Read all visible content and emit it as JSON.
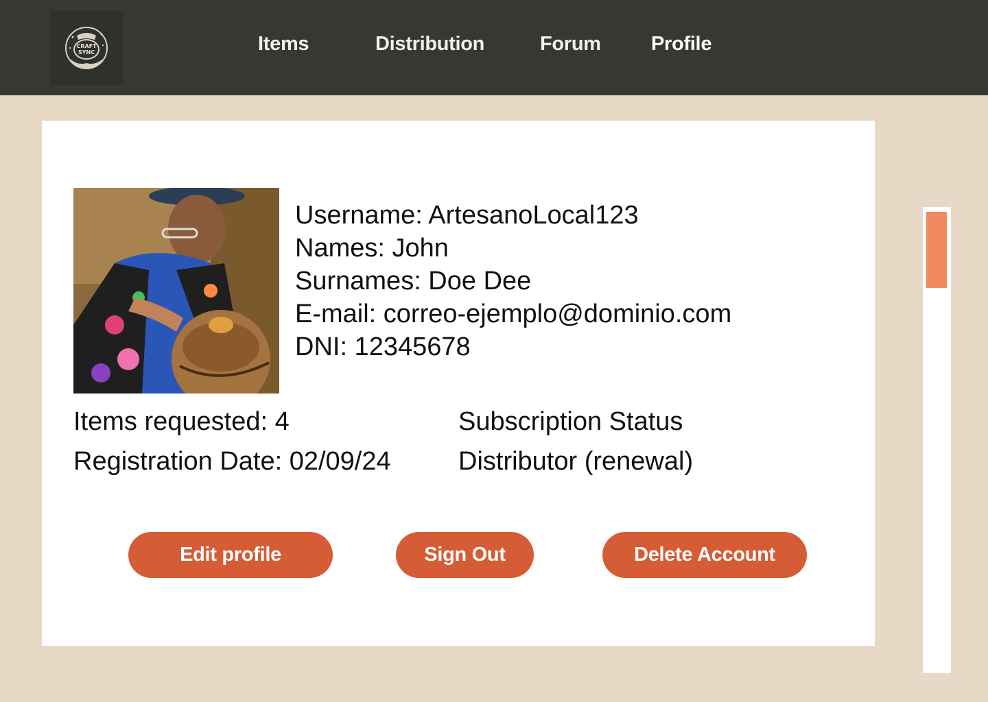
{
  "header": {
    "logo_text_top": "CRAFT",
    "logo_text_bottom": "SYNC",
    "nav": [
      {
        "label": "Items",
        "active": false
      },
      {
        "label": "Distribution",
        "active": false
      },
      {
        "label": "Forum",
        "active": false
      },
      {
        "label": "Profile",
        "active": true
      }
    ]
  },
  "profile": {
    "username": "Username: ArtesanoLocal123",
    "names": "Names: John",
    "surnames": "Surnames: Doe Dee",
    "email": "E-mail: correo-ejemplo@dominio.com",
    "dni": "DNI: 12345678",
    "items_requested": "Items requested: 4",
    "registration_date": "Registration Date: 02/09/24",
    "subscription_label": "Subscription Status",
    "subscription_value": "Distributor (renewal)"
  },
  "actions": {
    "edit": "Edit profile",
    "signout": "Sign Out",
    "delete": "Delete Account"
  },
  "colors": {
    "header_bg": "#363833",
    "page_bg": "#e8d8c6",
    "button": "#d55c35",
    "scroll_thumb": "#ee8a5e"
  },
  "icons": {
    "logo": "craft-sync-logo-icon",
    "avatar": "artisan-photo"
  }
}
